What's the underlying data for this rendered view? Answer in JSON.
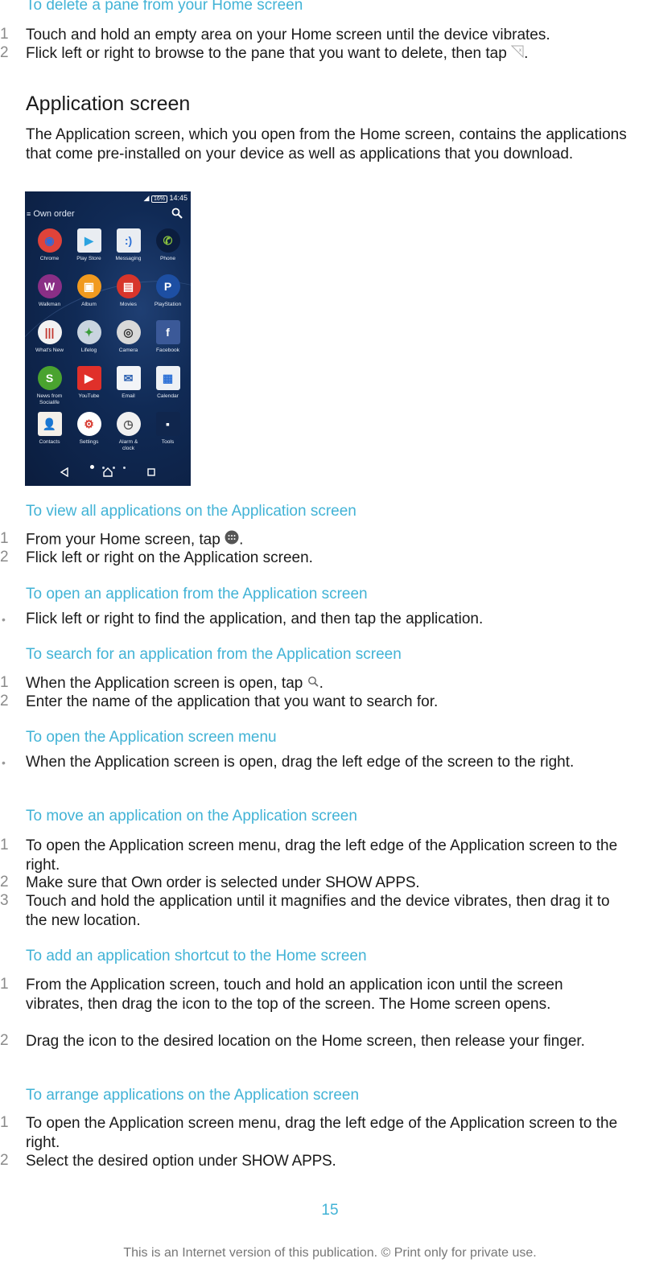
{
  "sections": {
    "delete_pane": {
      "heading": "To delete a pane from your Home screen",
      "steps": [
        {
          "num": "1",
          "text": "Touch and hold an empty area on your Home screen until the device vibrates."
        },
        {
          "num": "2",
          "text_before": "Flick left or right to browse to the pane that you want to delete, then tap ",
          "icon": "remove-pane-icon",
          "text_after": "."
        }
      ]
    },
    "application_screen": {
      "title": "Application screen",
      "intro": "The Application screen, which you open from the Home screen, contains the applications that come pre-installed on your device as well as applications that you download."
    },
    "view_all": {
      "heading": "To view all applications on the Application screen",
      "steps": [
        {
          "num": "1",
          "text_before": "From your Home screen, tap ",
          "icon": "apps-grid-icon",
          "text_after": "."
        },
        {
          "num": "2",
          "text": "Flick left or right on the Application screen."
        }
      ]
    },
    "open_app": {
      "heading": "To open an application from the Application screen",
      "bullet": "Flick left or right to find the application, and then tap the application."
    },
    "search_app": {
      "heading": "To search for an application from the Application screen",
      "steps": [
        {
          "num": "1",
          "text_before": "When the Application screen is open, tap ",
          "icon": "search-icon",
          "text_after": "."
        },
        {
          "num": "2",
          "text": "Enter the name of the application that you want to search for."
        }
      ]
    },
    "open_menu": {
      "heading": "To open the Application screen menu",
      "bullet": "When the Application screen is open, drag the left edge of the screen to the right."
    },
    "move_app": {
      "heading": "To move an application on the Application screen",
      "steps": [
        {
          "num": "1",
          "text": "To open the Application screen menu, drag the left edge of the Application screen to the right."
        },
        {
          "num": "2",
          "text_before": "Make sure that ",
          "ui1": "Own order",
          "text_middle": " is selected under ",
          "ui2": "SHOW APPS",
          "text_after": "."
        },
        {
          "num": "3",
          "text": "Touch and hold the application until it magnifies and the device vibrates, then drag it to the new location."
        }
      ]
    },
    "add_shortcut": {
      "heading": "To add an application shortcut to the Home screen",
      "steps": [
        {
          "num": "1",
          "text": "From the Application screen, touch and hold an application icon until the screen vibrates, then drag the icon to the top of the screen. The Home screen opens."
        },
        {
          "num": "2",
          "text": "Drag the icon to the desired location on the Home screen, then release your finger."
        }
      ]
    },
    "arrange_apps": {
      "heading": "To arrange applications on the Application screen",
      "steps": [
        {
          "num": "1",
          "text": "To open the Application screen menu, drag the left edge of the Application screen to the right."
        },
        {
          "num": "2",
          "text_before": "Select the desired option under ",
          "ui": "SHOW APPS",
          "text_after": "."
        }
      ]
    }
  },
  "phone": {
    "status_battery": "16%",
    "status_time": "14:45",
    "appbar_title": "Own order",
    "apps": [
      {
        "label": "Chrome",
        "icon": "chrome-icon",
        "color": "#e0433a"
      },
      {
        "label": "Play Store",
        "icon": "play-store-icon",
        "color": "#e9edf2"
      },
      {
        "label": "Messaging",
        "icon": "messaging-icon",
        "color": "#e9edf2"
      },
      {
        "label": "Phone",
        "icon": "phone-icon",
        "color": "#0b1d3e"
      },
      {
        "label": "Walkman",
        "icon": "walkman-icon",
        "color": "#8a2f86"
      },
      {
        "label": "Album",
        "icon": "album-icon",
        "color": "#f19a1f"
      },
      {
        "label": "Movies",
        "icon": "movies-icon",
        "color": "#d7352b"
      },
      {
        "label": "PlayStation",
        "icon": "playstation-icon",
        "color": "#1d4fa3"
      },
      {
        "label": "What's New",
        "icon": "whats-new-icon",
        "color": "#f2f2f2"
      },
      {
        "label": "Lifelog",
        "icon": "lifelog-icon",
        "color": "#c9d4df"
      },
      {
        "label": "Camera",
        "icon": "camera-icon",
        "color": "#d9d9d9"
      },
      {
        "label": "Facebook",
        "icon": "facebook-icon",
        "color": "#3b5998"
      },
      {
        "label": "News from\nSocialife",
        "icon": "socialife-icon",
        "color": "#4aa32f"
      },
      {
        "label": "YouTube",
        "icon": "youtube-icon",
        "color": "#e0302a"
      },
      {
        "label": "Email",
        "icon": "email-icon",
        "color": "#f2f4f7"
      },
      {
        "label": "Calendar",
        "icon": "calendar-icon",
        "color": "#eef1f5"
      },
      {
        "label": "Contacts",
        "icon": "contacts-icon",
        "color": "#f4f0ea"
      },
      {
        "label": "Settings",
        "icon": "settings-icon",
        "color": "#ffffff"
      },
      {
        "label": "Alarm &\nclock",
        "icon": "alarm-clock-icon",
        "color": "#f0f0f0"
      },
      {
        "label": "Tools",
        "icon": "tools-icon",
        "color": "#10264d"
      }
    ],
    "page_count": 4,
    "current_page": 1
  },
  "footer": {
    "page_number": "15",
    "notice": "This is an Internet version of this publication. © Print only for private use."
  }
}
